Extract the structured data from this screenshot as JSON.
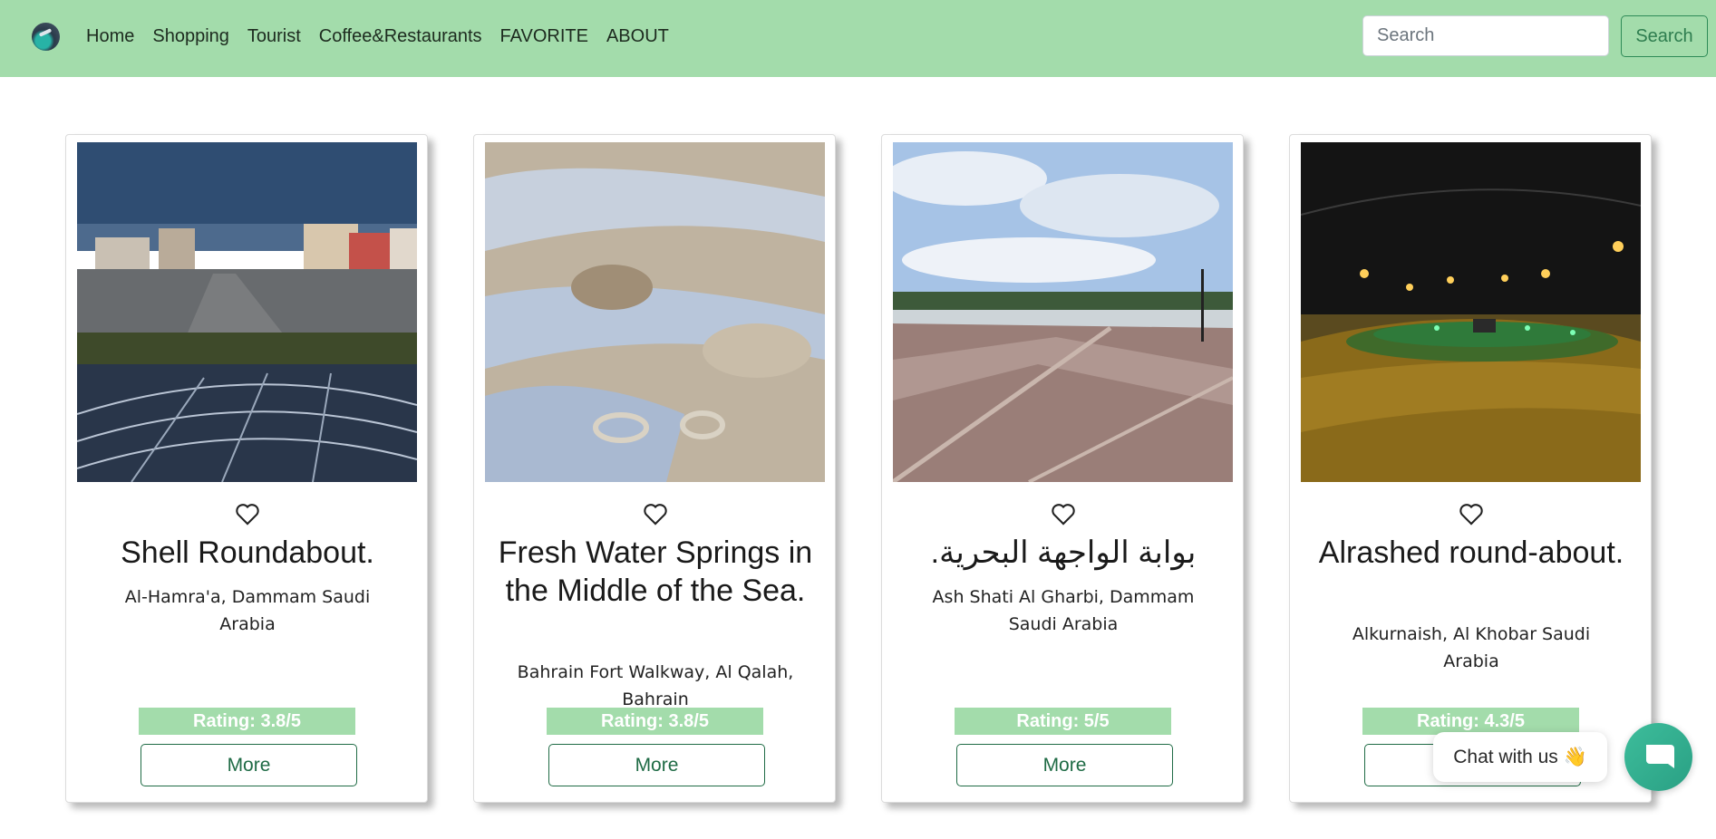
{
  "nav": {
    "logo_icon": "globe-plane-icon",
    "links": [
      "Home",
      "Shopping",
      "Tourist",
      "Coffee&Restaurants",
      "FAVORITE",
      "ABOUT"
    ],
    "search_placeholder": "Search",
    "search_button": "Search"
  },
  "cards": [
    {
      "title": "Shell Roundabout.",
      "location": "Al-Hamra'a, Dammam Saudi Arabia",
      "rating": "Rating: 3.8/5",
      "more": "More"
    },
    {
      "title": "Fresh Water Springs in the Middle of the Sea.",
      "location": "Bahrain Fort Walkway, Al Qalah, Bahrain",
      "rating": "Rating: 3.8/5",
      "more": "More"
    },
    {
      "title": "بوابة الواجهة البحرية.",
      "location": "Ash Shati Al Gharbi, Dammam Saudi Arabia",
      "rating": "Rating: 5/5",
      "more": "More"
    },
    {
      "title": "Alrashed round-about.",
      "location": "Alkurnaish, Al Khobar Saudi Arabia",
      "rating": "Rating: 4.3/5",
      "more": "More"
    }
  ],
  "chat": {
    "label": "Chat with us 👋",
    "icon": "chat-bubble-icon"
  },
  "colors": {
    "navbar": "#a3dcab",
    "rating_bg": "#a3dcab",
    "accent": "#1f6b45",
    "chat_button": "#3dbd9b"
  }
}
